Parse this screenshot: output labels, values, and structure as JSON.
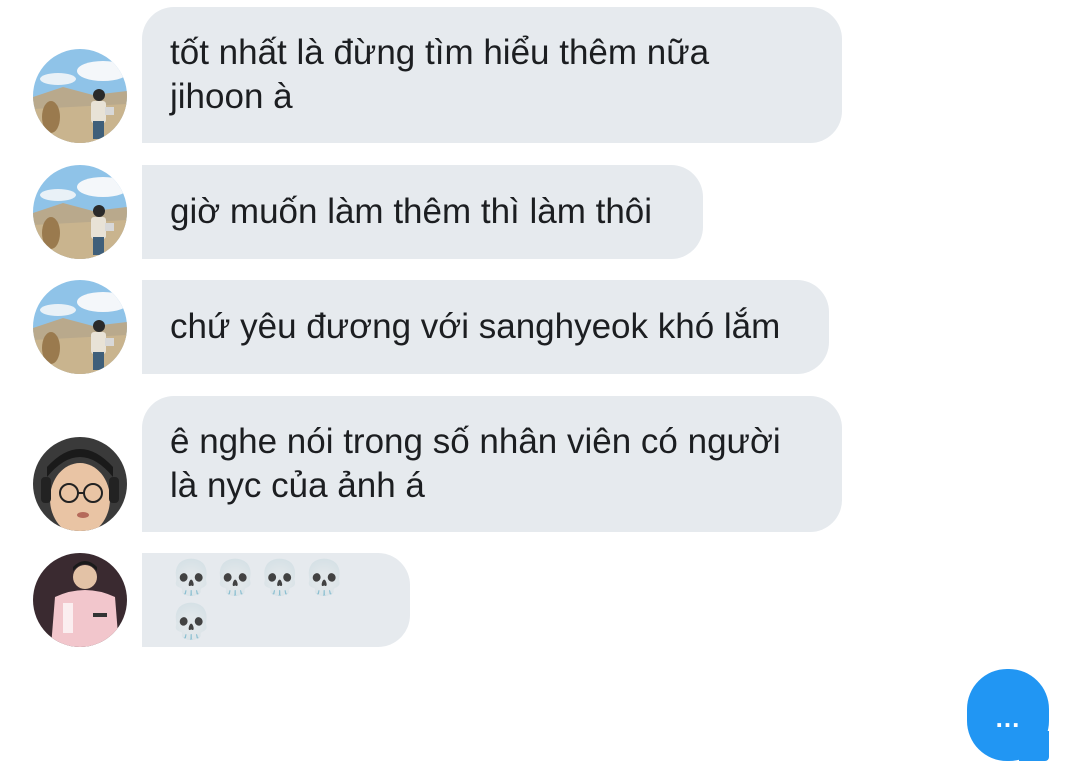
{
  "conversation": {
    "messages": [
      {
        "sender": "user-a",
        "avatar": "avatar-landscape-icon",
        "text": "tốt nhất là đừng tìm hiểu thêm nữa\njihoon à"
      },
      {
        "sender": "user-a",
        "avatar": "avatar-landscape-icon",
        "text": "giờ muốn làm thêm thì làm thôi"
      },
      {
        "sender": "user-a",
        "avatar": "avatar-landscape-icon",
        "text": "chứ yêu đương với sanghyeok khó lắm"
      },
      {
        "sender": "user-b",
        "avatar": "avatar-glasses-icon",
        "text": "ê nghe nói trong số nhân viên có người\nlà nyc của ảnh á"
      },
      {
        "sender": "user-c",
        "avatar": "avatar-jacket-icon",
        "text": "💀💀💀💀💀"
      }
    ]
  },
  "composer": {
    "typing_indicator": "...",
    "button_color": "#2196f3"
  },
  "colors": {
    "bubble_background": "#e6eaee",
    "text": "#1c1e21",
    "page_background": "#ffffff"
  }
}
